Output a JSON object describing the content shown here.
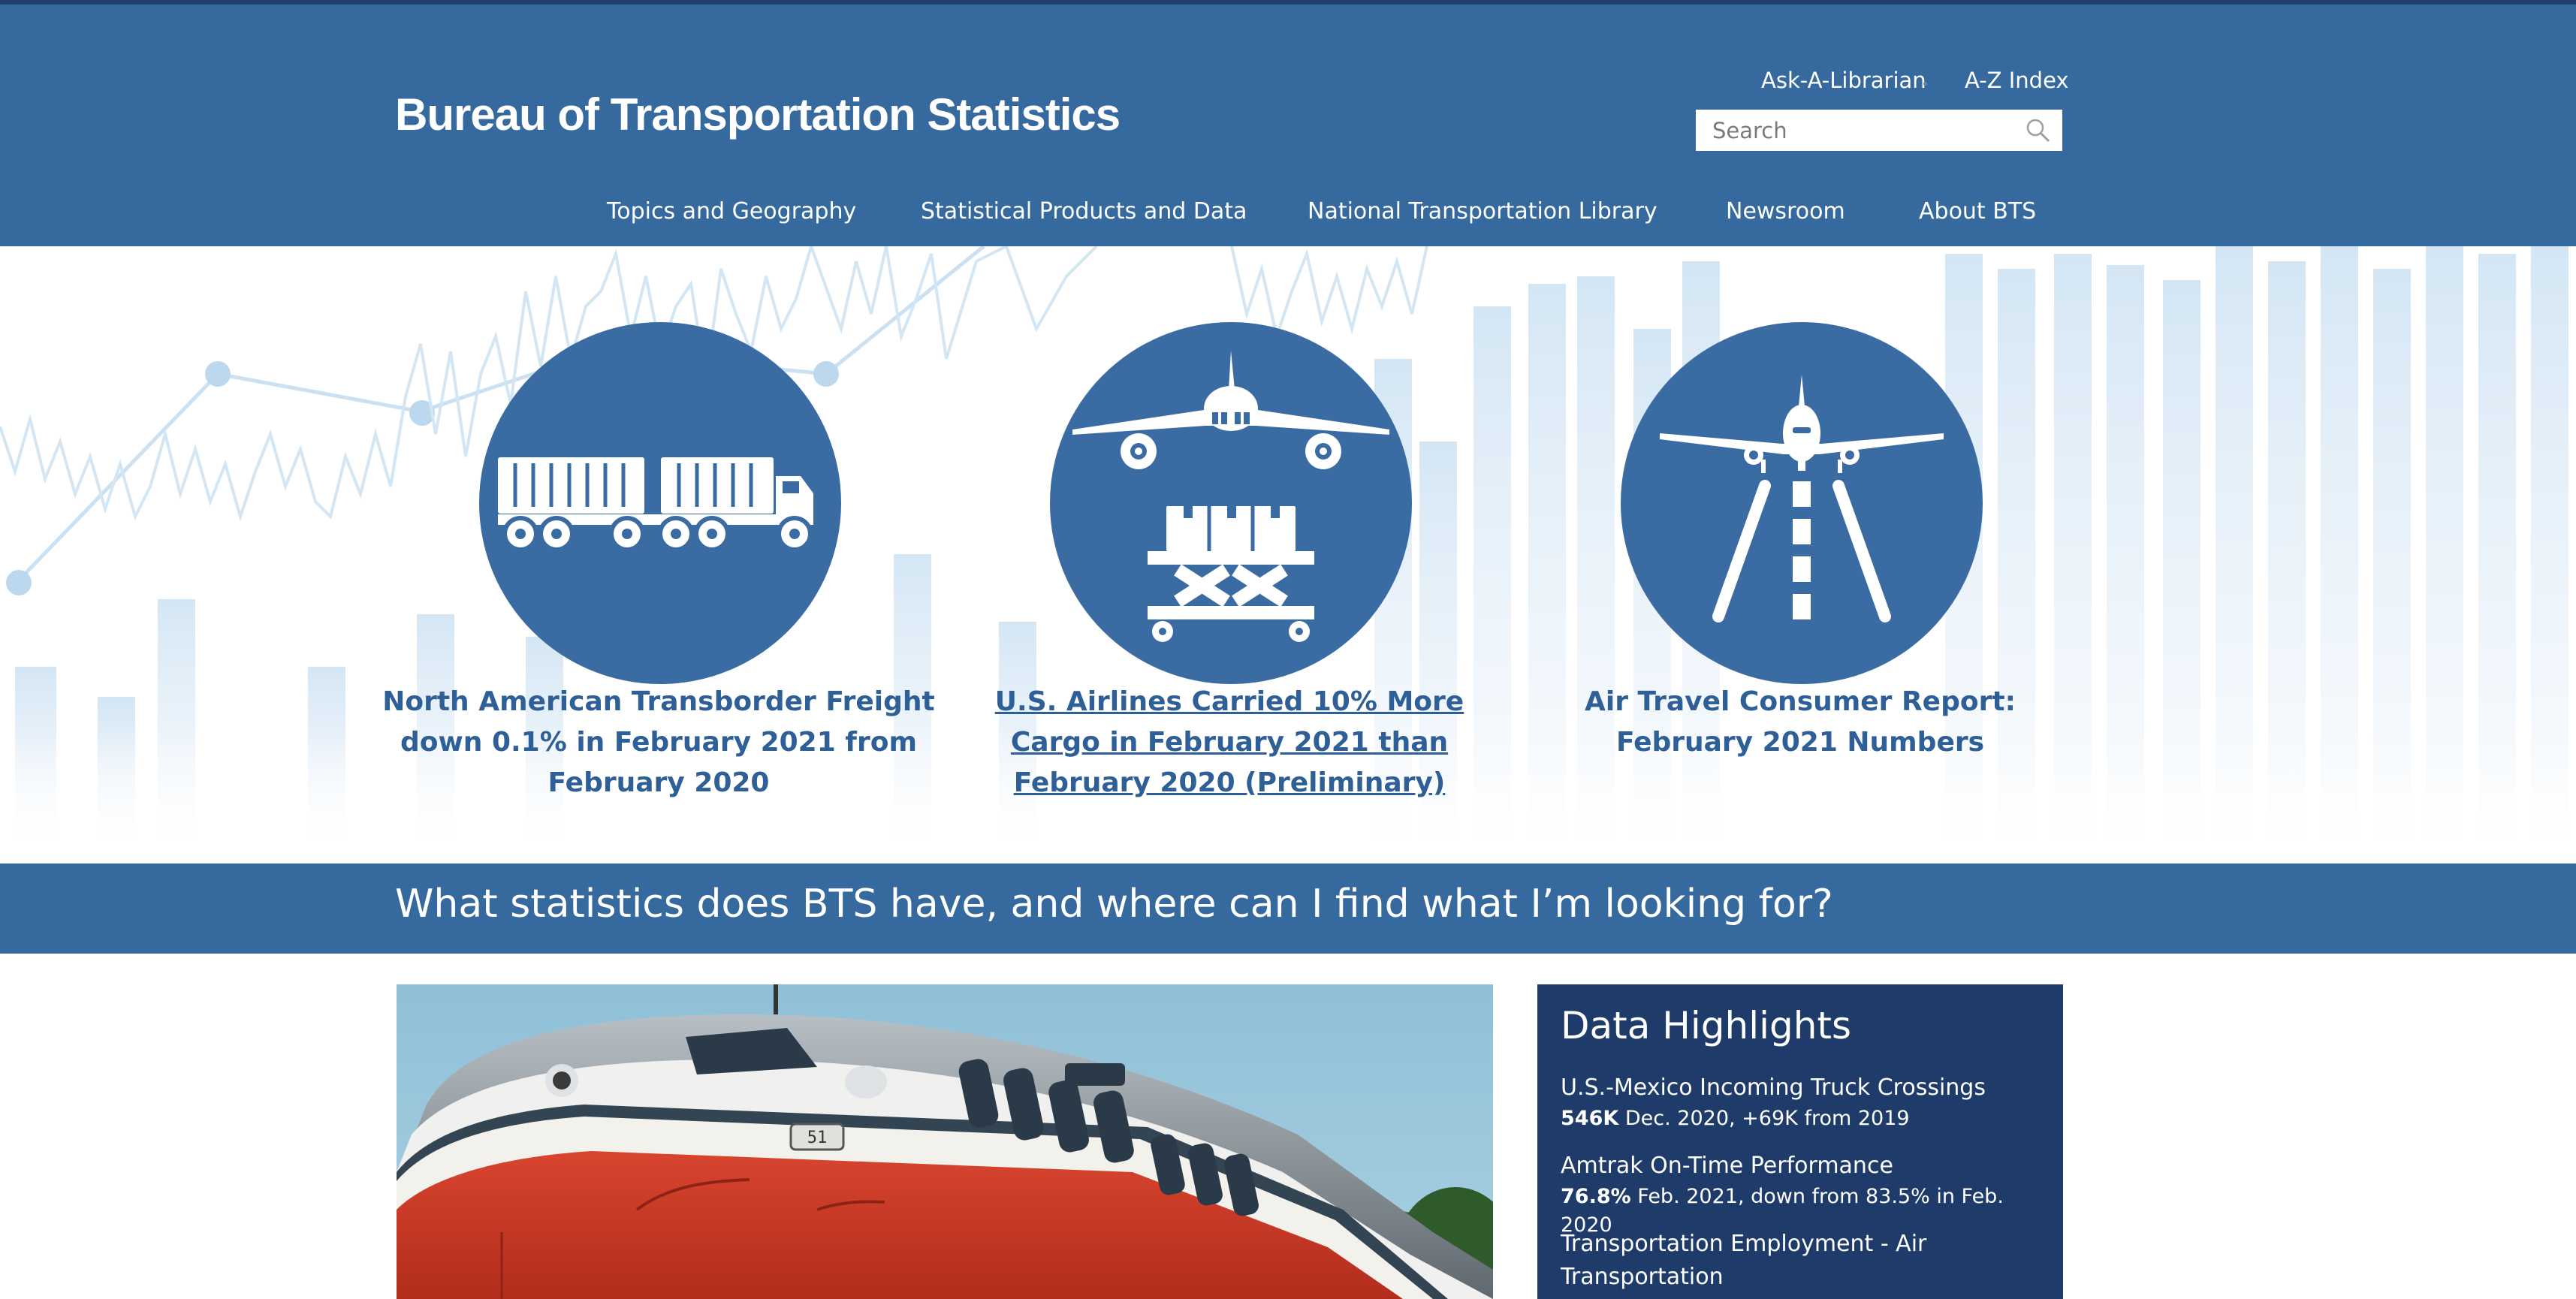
{
  "header": {
    "logo_text": "Bureau of Transportation Statistics",
    "utility_links": [
      "Ask-A-Librarian",
      "A-Z Index"
    ],
    "search_placeholder": "Search"
  },
  "nav": {
    "items": [
      "Topics and Geography",
      "Statistical Products and Data",
      "National Transportation Library",
      "Newsroom",
      "About BTS"
    ]
  },
  "featured": [
    {
      "title": "North American Transborder Freight down 0.1% in February 2021 from February 2020",
      "icon": "truck-icon"
    },
    {
      "title": "U.S. Airlines Carried 10% More Cargo in February 2021 than February 2020 (Preliminary)",
      "icon": "airplane-cargo-icon"
    },
    {
      "title": "Air Travel Consumer Report: February 2021 Numbers",
      "icon": "airplane-runway-icon"
    }
  ],
  "band": {
    "heading": "What statistics does BTS have, and where can I find what I’m looking for?"
  },
  "highlights": {
    "title": "Data Highlights",
    "items": [
      {
        "label": "U.S.-Mexico Incoming Truck Crossings",
        "value": "546K",
        "detail": "Dec. 2020, +69K from 2019"
      },
      {
        "label": "Amtrak On-Time Performance",
        "value": "76.8%",
        "detail": "Feb. 2021, down from 83.5% in Feb. 2020"
      },
      {
        "label": "Transportation Employment - Air Transportation",
        "value": "",
        "detail": ""
      }
    ]
  },
  "colors": {
    "header_blue": "#366a9f",
    "top_line": "#243e6b",
    "highlights_navy": "#1f3b6a",
    "link_blue": "#2e5f97",
    "icon_circle_blue": "#3a6ca3"
  }
}
